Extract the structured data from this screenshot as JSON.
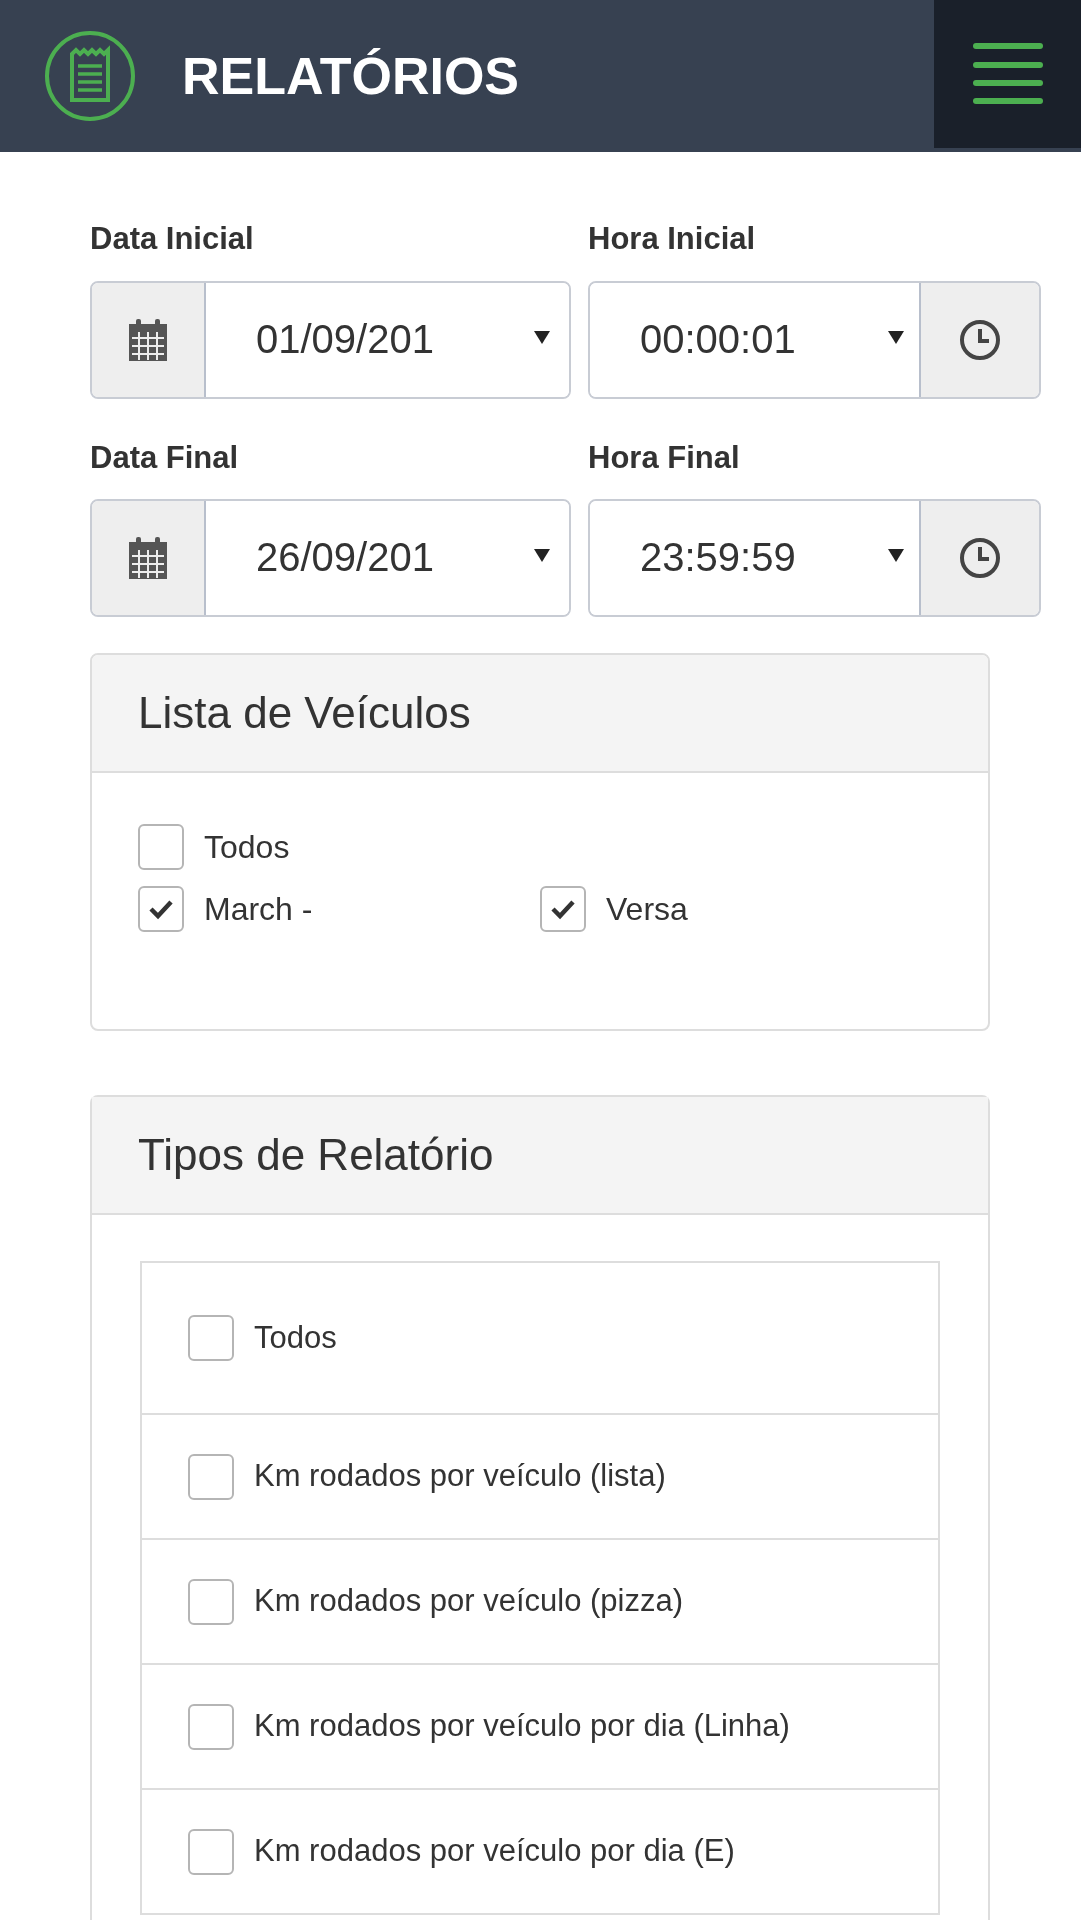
{
  "header": {
    "title": "RELATÓRIOS"
  },
  "date_rows": [
    {
      "date_label": "Data Inicial",
      "date_value": "01/09/201",
      "time_label": "Hora Inicial",
      "time_value": "00:00:01"
    },
    {
      "date_label": "Data Final",
      "date_value": "26/09/201",
      "time_label": "Hora Final",
      "time_value": "23:59:59"
    }
  ],
  "vehicles": {
    "title": "Lista de Veículos",
    "all": {
      "label": "Todos",
      "checked": false
    },
    "items": [
      {
        "label": "March -",
        "checked": true
      },
      {
        "label": "Versa",
        "checked": true
      }
    ]
  },
  "report_types": {
    "title": "Tipos de Relatório",
    "items": [
      {
        "label": "Todos",
        "checked": false
      },
      {
        "label": "Km rodados por veículo (lista)",
        "checked": false
      },
      {
        "label": "Km rodados por veículo (pizza)",
        "checked": false
      },
      {
        "label": "Km rodados por veículo por dia (Linha)",
        "checked": false
      },
      {
        "label": "Km rodados por veículo por dia (E)",
        "checked": false
      }
    ]
  }
}
